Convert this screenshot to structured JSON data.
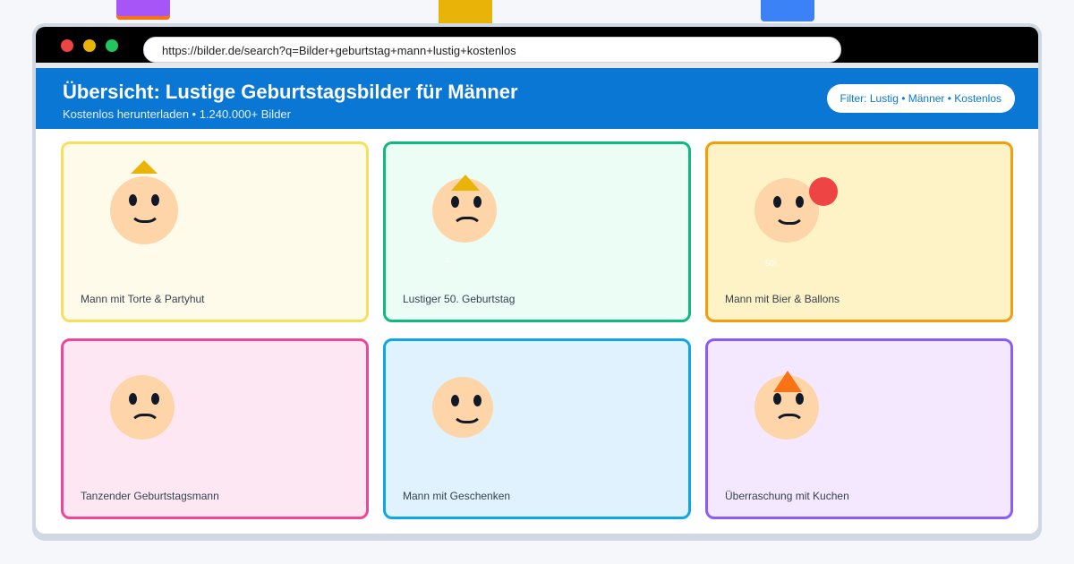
{
  "browser": {
    "url": "https://bilder.de/search?q=Bilder+geburtstag+mann+lustig+kostenlos"
  },
  "header": {
    "title": "Übersicht: Lustige Geburtstagsbilder für Männer",
    "subtitle": "Kostenlos herunterladen • 1.240.000+ Bilder",
    "filter": "Filter: Lustig • Männer • Kostenlos"
  },
  "colors": {
    "header_blue": "#0a77d5",
    "card_borders": [
      "#f6e05e",
      "#10b981",
      "#f59e0b",
      "#ec4899",
      "#0ea5e9",
      "#8b5cf6"
    ],
    "card_backgrounds": [
      "#fffbeb",
      "#ecfdf5",
      "#fef3c7",
      "#fde7f3",
      "#e0f2fe",
      "#f3e8ff"
    ]
  },
  "cards": [
    {
      "caption": "Mann mit Torte & Partyhut",
      "expression": "smile",
      "hat": "yellow-hat-icon"
    },
    {
      "caption": "Lustiger 50. Geburtstag",
      "expression": "frown",
      "hat": "yellow-hat-icon",
      "extra_text": "x"
    },
    {
      "caption": "Mann mit Bier & Ballons",
      "expression": "smile",
      "balloon": "red-balloon-icon",
      "extra_text": "50!"
    },
    {
      "caption": "Tanzender Geburtstagsmann",
      "expression": "frown"
    },
    {
      "caption": "Mann mit Geschenken",
      "expression": "smile"
    },
    {
      "caption": "Überraschung mit Kuchen",
      "expression": "frown",
      "hat": "orange-hat-icon"
    }
  ]
}
